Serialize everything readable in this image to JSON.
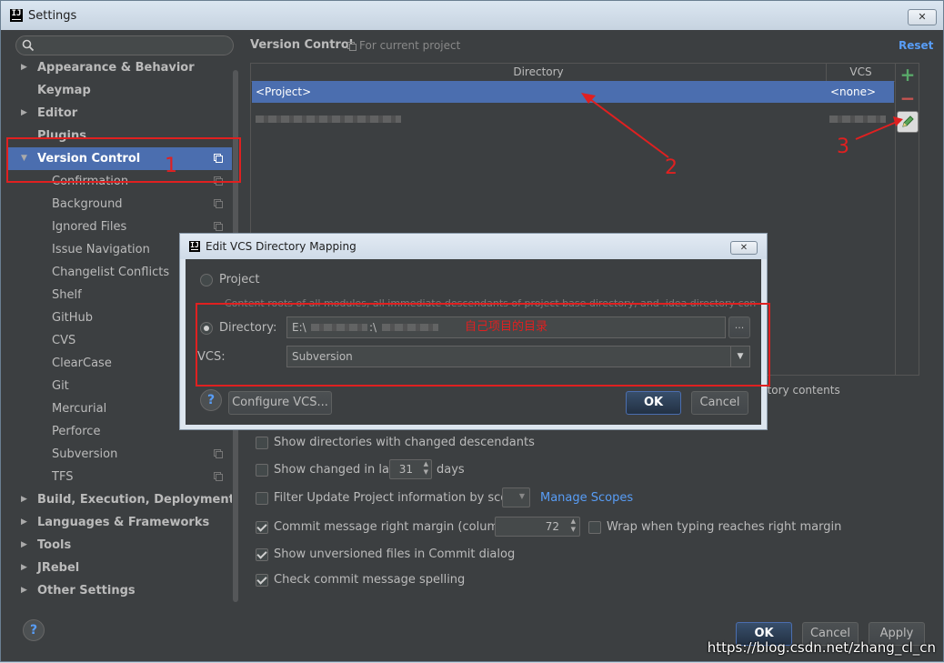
{
  "window": {
    "title": "Settings",
    "close_glyph": "✕"
  },
  "sidebar": {
    "items": [
      {
        "label": "Appearance & Behavior",
        "arrow": "▶"
      },
      {
        "label": "Keymap"
      },
      {
        "label": "Editor",
        "arrow": "▶"
      },
      {
        "label": "Plugins"
      },
      {
        "label": "Version Control",
        "arrow": "▼"
      },
      {
        "label": "Confirmation"
      },
      {
        "label": "Background"
      },
      {
        "label": "Ignored Files"
      },
      {
        "label": "Issue Navigation"
      },
      {
        "label": "Changelist Conflicts"
      },
      {
        "label": "Shelf"
      },
      {
        "label": "GitHub"
      },
      {
        "label": "CVS"
      },
      {
        "label": "ClearCase"
      },
      {
        "label": "Git"
      },
      {
        "label": "Mercurial"
      },
      {
        "label": "Perforce"
      },
      {
        "label": "Subversion"
      },
      {
        "label": "TFS"
      },
      {
        "label": "Build, Execution, Deployment",
        "arrow": "▶"
      },
      {
        "label": "Languages & Frameworks",
        "arrow": "▶"
      },
      {
        "label": "Tools",
        "arrow": "▶"
      },
      {
        "label": "JRebel",
        "arrow": "▶"
      },
      {
        "label": "Other Settings",
        "arrow": "▶"
      }
    ]
  },
  "main": {
    "title": "Version Control",
    "subtitle": "For current project",
    "reset": "Reset",
    "table": {
      "headers": [
        "Directory",
        "VCS"
      ],
      "rows": [
        {
          "directory": "<Project>",
          "vcs": "<none>"
        }
      ]
    },
    "toolstrip": {
      "add": "+",
      "remove": "−"
    },
    "hidden_text_fragment": "ctory contents",
    "options": {
      "show_dirs": "Show directories with changed descendants",
      "show_changed_prefix": "Show changed in last",
      "show_changed_value": "31",
      "show_changed_suffix": "days",
      "filter_update": "Filter Update Project information by scope",
      "manage_scopes": "Manage Scopes",
      "commit_margin": "Commit message right margin (columns):",
      "commit_margin_value": "72",
      "wrap_typing": "Wrap when typing reaches right margin",
      "show_unversioned": "Show unversioned files in Commit dialog",
      "check_spelling": "Check commit message spelling"
    }
  },
  "footer": {
    "help": "?",
    "ok": "OK",
    "cancel": "Cancel",
    "apply": "Apply"
  },
  "dialog": {
    "title": "Edit VCS Directory Mapping",
    "project_label": "Project",
    "project_hint": "Content roots of all modules, all immediate descendants of project base directory, and .idea directory contents",
    "directory_label": "Directory:",
    "directory_value": "E:\\",
    "directory_value_2": ":\\",
    "directory_note": "自己项目的目录",
    "browse": "...",
    "vcs_label": "VCS:",
    "vcs_value": "Subversion",
    "configure": "Configure VCS...",
    "ok": "OK",
    "cancel": "Cancel",
    "help": "?"
  },
  "annotations": {
    "one": "1",
    "two": "2",
    "three": "3"
  },
  "watermark": "https://blog.csdn.net/zhang_cl_cn",
  "colors": {
    "selection": "#4b6eaf",
    "annotation_red": "#e02020",
    "link": "#589df6",
    "add_green": "#59a869",
    "remove_red": "#c75450"
  }
}
